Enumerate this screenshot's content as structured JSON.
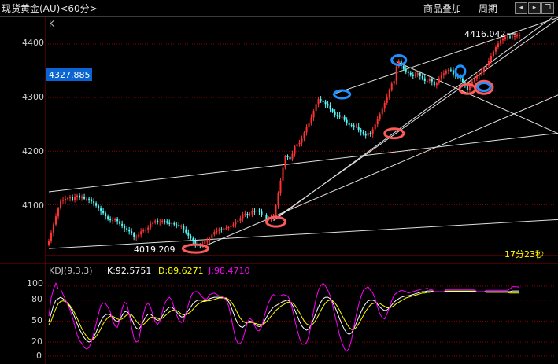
{
  "header": {
    "title": "现货黄金(AU)<60分>",
    "indicator_button": "商品叠加",
    "period_button": "周期",
    "window_buttons": [
      "left-arrow-icon",
      "right-arrow-icon",
      "restore-icon"
    ]
  },
  "main_panel": {
    "label": "K",
    "y_ticks": [
      "4400",
      "4300",
      "4200",
      "4100"
    ],
    "current_price_label": "4327.885",
    "high_label": "4416.042",
    "low_label": "4019.209",
    "countdown": "17分23秒"
  },
  "kdj_panel": {
    "name": "KDJ(9,3,3)",
    "k_label": "K:92.5751",
    "d_label": "D:89.6271",
    "j_label": "J:98.4710",
    "y_ticks": [
      "100",
      "80",
      "50",
      "20",
      "0"
    ]
  },
  "colors": {
    "background": "#000000",
    "up_candle": "#ff3232",
    "down_candle": "#54fcfc",
    "k_line": "#ffffff",
    "d_line": "#ffff00",
    "j_line": "#ff00ff",
    "grid": "#8b0000",
    "highlight_box": "#0a64d2",
    "high_marker": "#1e90ff",
    "low_marker": "#ff5a5a"
  },
  "chart_data": [
    {
      "type": "candlestick",
      "title": "现货黄金(AU)<60分>",
      "ylim": [
        4005,
        4450
      ],
      "y_ticks": [
        4100,
        4200,
        4300,
        4400
      ],
      "x": [
        0,
        1,
        2,
        3,
        4,
        5,
        6,
        7,
        8,
        9,
        10,
        11,
        12,
        13,
        14,
        15,
        16,
        17,
        18,
        19,
        20,
        21,
        22,
        23,
        24,
        25,
        26,
        27,
        28,
        29,
        30,
        31,
        32,
        33,
        34,
        35,
        36,
        37,
        38,
        39,
        40,
        41,
        42,
        43,
        44,
        45,
        46,
        47,
        48,
        49,
        50,
        51,
        52,
        53,
        54,
        55,
        56,
        57,
        58,
        59,
        60,
        61,
        62,
        63,
        64,
        65,
        66,
        67,
        68,
        69,
        70,
        71,
        72,
        73,
        74,
        75,
        76,
        77,
        78,
        79,
        80,
        81,
        82,
        83,
        84,
        85,
        86,
        87,
        88,
        89,
        90,
        91,
        92,
        93,
        94,
        95,
        96,
        97,
        98,
        99,
        100,
        101,
        102,
        103,
        104,
        105,
        106,
        107,
        108,
        109,
        110,
        111,
        112,
        113,
        114,
        115,
        116,
        117,
        118,
        119,
        120,
        121,
        122,
        123,
        124,
        125,
        126,
        127,
        128,
        129,
        130,
        131,
        132,
        133,
        134,
        135,
        136,
        137,
        138,
        139,
        140,
        141,
        142,
        143,
        144,
        145,
        146,
        147,
        148,
        149,
        150,
        151,
        152,
        153,
        154,
        155,
        156,
        157,
        158,
        159,
        160,
        161,
        162,
        163,
        164,
        165,
        166,
        167,
        168,
        169,
        170,
        171,
        172,
        173,
        174,
        175,
        176,
        177,
        178,
        179,
        180,
        181,
        182,
        183,
        184,
        185,
        186,
        187,
        188,
        189,
        190,
        191,
        192,
        193,
        194,
        195,
        196,
        197,
        198,
        199
      ],
      "close": [
        4033,
        4048,
        4063,
        4078,
        4093,
        4107,
        4109,
        4111,
        4112,
        4114,
        4109,
        4114,
        4117,
        4113,
        4114,
        4111,
        4111,
        4110,
        4106,
        4103,
        4098,
        4093,
        4088,
        4084,
        4078,
        4073,
        4071,
        4071,
        4073,
        4069,
        4064,
        4061,
        4056,
        4053,
        4050,
        4046,
        4039,
        4040,
        4044,
        4050,
        4053,
        4053,
        4057,
        4064,
        4066,
        4070,
        4068,
        4068,
        4070,
        4069,
        4066,
        4064,
        4065,
        4063,
        4062,
        4060,
        4060,
        4054,
        4048,
        4042,
        4037,
        4032,
        4027,
        4025,
        4024,
        4027,
        4032,
        4032,
        4037,
        4044,
        4049,
        4051,
        4054,
        4052,
        4056,
        4056,
        4058,
        4061,
        4063,
        4068,
        4070,
        4075,
        4081,
        4083,
        4081,
        4082,
        4088,
        4087,
        4089,
        4087,
        4080,
        4081,
        4074,
        4074,
        4077,
        4077,
        4099,
        4121,
        4145,
        4169,
        4190,
        4189,
        4185,
        4195,
        4209,
        4213,
        4216,
        4223,
        4235,
        4246,
        4253,
        4263,
        4275,
        4288,
        4297,
        4293,
        4292,
        4288,
        4285,
        4278,
        4274,
        4268,
        4267,
        4264,
        4264,
        4258,
        4253,
        4249,
        4248,
        4246,
        4246,
        4240,
        4236,
        4233,
        4229,
        4234,
        4232,
        4241,
        4250,
        4259,
        4269,
        4279,
        4290,
        4302,
        4314,
        4326,
        4331,
        4358,
        4369,
        4359,
        4353,
        4349,
        4346,
        4343,
        4340,
        4343,
        4346,
        4340,
        4336,
        4331,
        4331,
        4334,
        4330,
        4323,
        4327,
        4336,
        4343,
        4345,
        4350,
        4352,
        4351,
        4343,
        4341,
        4339,
        4336,
        4329,
        4323,
        4314,
        4324,
        4330,
        4336,
        4341,
        4344,
        4349,
        4355,
        4360,
        4369,
        4378,
        4386,
        4394,
        4401,
        4407,
        4410,
        4413,
        4414,
        4413,
        4414,
        4415,
        4416,
        4416
      ],
      "ohlc_open_is_previous_close": true
    },
    {
      "type": "line",
      "title": "KDJ(9,3,3)",
      "ylim": [
        -8,
        110
      ],
      "y_ticks": [
        0,
        20,
        50,
        80,
        100
      ],
      "latest": {
        "K": 92.5751,
        "D": 89.6271,
        "J": 98.471
      },
      "series": [
        {
          "name": "K",
          "color": "#ffffff",
          "values": [
            49,
            61,
            72,
            80,
            82,
            84,
            82,
            79,
            75,
            70,
            63,
            55,
            46,
            38,
            32,
            26,
            22,
            20,
            22,
            27,
            34,
            42,
            50,
            56,
            59,
            60,
            59,
            55,
            51,
            49,
            52,
            58,
            63,
            64,
            60,
            53,
            45,
            40,
            38,
            43,
            50,
            56,
            60,
            60,
            57,
            53,
            51,
            52,
            57,
            63,
            67,
            70,
            70,
            67,
            63,
            59,
            56,
            56,
            60,
            65,
            70,
            75,
            78,
            80,
            80,
            80,
            79,
            80,
            82,
            83,
            84,
            84,
            84,
            84,
            83,
            82,
            78,
            71,
            62,
            53,
            46,
            42,
            41,
            44,
            48,
            50,
            49,
            46,
            43,
            42,
            44,
            49,
            55,
            61,
            66,
            70,
            72,
            74,
            76,
            78,
            79,
            80,
            78,
            73,
            66,
            58,
            50,
            43,
            39,
            37,
            39,
            45,
            53,
            62,
            70,
            77,
            82,
            84,
            84,
            82,
            77,
            70,
            62,
            53,
            45,
            38,
            33,
            31,
            33,
            39,
            47,
            55,
            63,
            70,
            75,
            79,
            80,
            80,
            78,
            74,
            70,
            67,
            65,
            66,
            69,
            73,
            77,
            80,
            82,
            84,
            85,
            86,
            86,
            87,
            88,
            89,
            90,
            91,
            92,
            92,
            93,
            93,
            93,
            92,
            92,
            92,
            92,
            92,
            93,
            93,
            93,
            93,
            93,
            93,
            93,
            93,
            93,
            93,
            93,
            93,
            93,
            92,
            92,
            92,
            92,
            92,
            92,
            92,
            92,
            92,
            92,
            92,
            92,
            92,
            92,
            92,
            93,
            93,
            93,
            93
          ]
        },
        {
          "name": "D",
          "color": "#ffff00",
          "values": [
            45,
            50,
            60,
            68,
            75,
            78,
            79,
            78,
            76,
            72,
            67,
            61,
            54,
            46,
            39,
            33,
            28,
            24,
            23,
            24,
            28,
            33,
            39,
            46,
            51,
            55,
            57,
            57,
            55,
            53,
            52,
            53,
            56,
            59,
            60,
            59,
            55,
            50,
            46,
            44,
            45,
            48,
            52,
            55,
            56,
            55,
            54,
            53,
            54,
            57,
            60,
            63,
            65,
            66,
            65,
            63,
            60,
            59,
            59,
            61,
            63,
            67,
            71,
            74,
            76,
            78,
            78,
            79,
            79,
            80,
            81,
            82,
            83,
            83,
            83,
            83,
            81,
            78,
            73,
            67,
            60,
            54,
            50,
            48,
            48,
            48,
            48,
            47,
            46,
            45,
            45,
            46,
            49,
            53,
            57,
            61,
            65,
            68,
            71,
            73,
            75,
            77,
            77,
            76,
            73,
            68,
            62,
            56,
            50,
            46,
            44,
            44,
            47,
            52,
            58,
            65,
            71,
            76,
            79,
            80,
            79,
            76,
            71,
            65,
            58,
            52,
            46,
            41,
            38,
            38,
            41,
            46,
            52,
            58,
            64,
            69,
            73,
            75,
            76,
            76,
            75,
            73,
            71,
            69,
            69,
            70,
            72,
            75,
            77,
            79,
            81,
            83,
            84,
            85,
            86,
            87,
            88,
            89,
            90,
            90,
            91,
            91,
            92,
            92,
            92,
            92,
            92,
            92,
            92,
            92,
            92,
            92,
            92,
            92,
            92,
            92,
            92,
            92,
            92,
            92,
            92,
            92,
            92,
            92,
            92,
            91,
            91,
            91,
            91,
            91,
            91,
            91,
            91,
            91,
            91,
            90,
            90,
            90,
            90,
            90
          ]
        },
        {
          "name": "J",
          "color": "#ff00ff",
          "values": [
            57,
            83,
            96,
            104,
            96,
            96,
            88,
            81,
            73,
            66,
            55,
            43,
            30,
            22,
            18,
            12,
            10,
            12,
            20,
            33,
            46,
            60,
            72,
            76,
            75,
            70,
            63,
            51,
            43,
            41,
            52,
            68,
            77,
            74,
            60,
            41,
            25,
            20,
            22,
            41,
            60,
            72,
            76,
            70,
            59,
            49,
            45,
            50,
            63,
            75,
            81,
            84,
            80,
            69,
            59,
            51,
            48,
            50,
            62,
            73,
            84,
            91,
            92,
            92,
            88,
            84,
            81,
            82,
            88,
            89,
            90,
            88,
            86,
            86,
            83,
            80,
            72,
            57,
            40,
            25,
            18,
            18,
            23,
            36,
            48,
            54,
            51,
            44,
            37,
            36,
            42,
            55,
            67,
            77,
            84,
            88,
            86,
            86,
            86,
            88,
            87,
            86,
            80,
            67,
            52,
            38,
            26,
            17,
            17,
            19,
            29,
            47,
            65,
            82,
            94,
            101,
            104,
            100,
            94,
            86,
            73,
            58,
            44,
            29,
            19,
            10,
            7,
            11,
            23,
            41,
            59,
            73,
            85,
            94,
            97,
            99,
            94,
            90,
            82,
            70,
            60,
            55,
            53,
            60,
            69,
            79,
            87,
            90,
            92,
            94,
            93,
            92,
            90,
            91,
            92,
            93,
            94,
            95,
            96,
            96,
            97,
            95,
            95,
            92,
            92,
            92,
            92,
            92,
            95,
            95,
            95,
            95,
            95,
            95,
            95,
            95,
            95,
            95,
            95,
            95,
            95,
            92,
            92,
            92,
            92,
            94,
            94,
            94,
            94,
            94,
            94,
            94,
            94,
            94,
            94,
            96,
            99,
            99,
            99,
            98
          ]
        }
      ]
    }
  ]
}
